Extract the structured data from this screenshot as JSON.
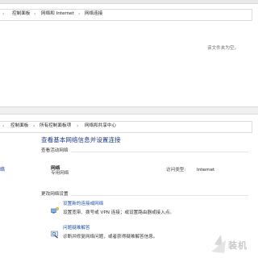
{
  "window1": {
    "breadcrumb": [
      "控制面板",
      "网络和 Internet",
      "网络连接"
    ],
    "empty_message": "该文件夹为空。"
  },
  "window2": {
    "breadcrumb": [
      "控制面板",
      "所有控制面板项",
      "网络和共享中心"
    ],
    "heading": "查看基本网络信息并设置连接",
    "active_networks_label": "查看活动网络",
    "left_fragment": "络",
    "network": {
      "name": "网络",
      "type": "专用网络",
      "access_type_label": "访问类型:",
      "access_type_value": "Internet"
    },
    "change_settings_label": "更改网络设置",
    "actions": [
      {
        "title": "设置新的连接或网络",
        "description": "设置宽带、拨号或 VPN 连接；或设置路由器或接入点。",
        "icon": "network-setup-icon"
      },
      {
        "title": "问题疑难解答",
        "description": "诊断并修复网络问题，或者获得疑难解答信息。",
        "icon": "troubleshoot-icon"
      }
    ]
  },
  "watermark": {
    "text": "装机"
  }
}
